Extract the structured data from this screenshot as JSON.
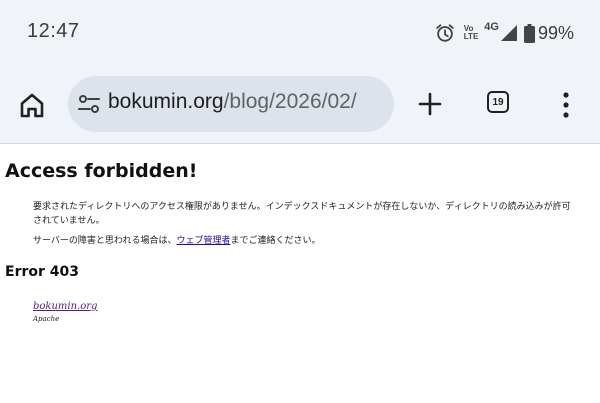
{
  "status_bar": {
    "time": "12:47",
    "volte_line1": "Vo",
    "volte_line2": "LTE",
    "network": "4G",
    "battery": "99%",
    "icons": [
      "alarm-icon",
      "signal-icon",
      "battery-icon"
    ]
  },
  "toolbar": {
    "url_host": "bokumin.org",
    "url_path": "/blog/2026/02/",
    "tab_count": "19",
    "icons": [
      "home-icon",
      "tune-icon",
      "plus-icon",
      "more-vert-icon"
    ]
  },
  "page": {
    "title": "Access forbidden!",
    "paragraph1": "要求されたディレクトリへのアクセス権限がありません。インデックスドキュメントが存在しないか、ディレクトリの読み込みが許可されていません。",
    "paragraph2_before": "サーバーの障害と思われる場合は、",
    "paragraph2_link": "ウェブ管理者",
    "paragraph2_after": "までご連絡ください。",
    "error_heading": "Error 403",
    "site_link": "bokumin.org",
    "server_software": "Apache"
  },
  "colors": {
    "chrome_bg": "#f0f4f9",
    "url_bar_bg": "#dde3ea",
    "link": "#1a0dab",
    "visited_link": "#551a8b"
  }
}
